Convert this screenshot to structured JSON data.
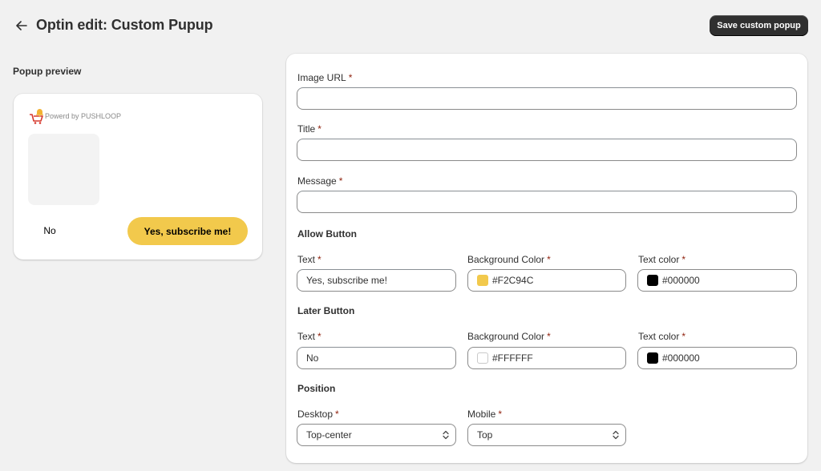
{
  "header": {
    "title": "Optin edit: Custom Pupup",
    "save_label": "Save custom popup"
  },
  "preview": {
    "heading": "Popup preview",
    "brand_text": "Powerd by PUSHLOOP",
    "no_label": "No",
    "yes_label": "Yes, subscribe me!",
    "yes_bg": "#F2C94C"
  },
  "form": {
    "image_url": {
      "label": "Image URL",
      "required_mark": "*",
      "value": ""
    },
    "title": {
      "label": "Title",
      "required_mark": "*",
      "value": ""
    },
    "message": {
      "label": "Message",
      "required_mark": "*",
      "value": ""
    },
    "allow_button": {
      "section": "Allow Button",
      "text_label": "Text",
      "text_value": "Yes, subscribe me!",
      "bg_label": "Background Color",
      "bg_value": "#F2C94C",
      "color_label": "Text color",
      "color_value": "#000000",
      "required_mark": "*"
    },
    "later_button": {
      "section": "Later Button",
      "text_label": "Text",
      "text_value": "No",
      "bg_label": "Background Color",
      "bg_value": "#FFFFFF",
      "color_label": "Text color",
      "color_value": "#000000",
      "required_mark": "*"
    },
    "position": {
      "section": "Position",
      "desktop_label": "Desktop",
      "desktop_value": "Top-center",
      "mobile_label": "Mobile",
      "mobile_value": "Top",
      "required_mark": "*"
    }
  },
  "icons": {
    "back": "arrow-left-icon",
    "brand": "pushloop-logo-icon",
    "select": "chevron-up-down-icon"
  },
  "colors": {
    "background": "#F1F1F1",
    "card": "#FFFFFF",
    "primary_button": "#303030",
    "required": "#8E1F0B",
    "swatch_yellow": "#F2C94C",
    "swatch_black": "#000000",
    "swatch_white": "#FFFFFF"
  }
}
